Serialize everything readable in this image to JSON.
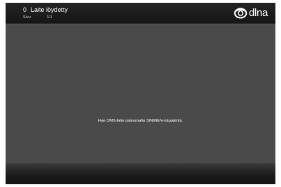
{
  "header": {
    "device_count": "0",
    "title": "Laite löydetty",
    "page_label": "Sivu:",
    "page_value": "1/1",
    "logo_text": "dlna",
    "logo_icon": "dlna-logo-icon"
  },
  "main": {
    "hint": "Hae DMS-laite painamalla SININEN-näppäintä."
  },
  "colors": {
    "header_bg": "#1b1b1b",
    "main_bg": "#4a4a4a",
    "text": "#ffffff"
  }
}
